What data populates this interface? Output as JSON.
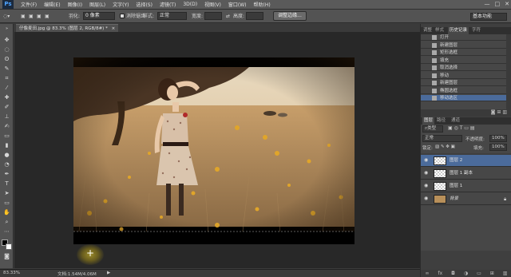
{
  "menubar": {
    "logo": "Ps",
    "items": [
      "文件(F)",
      "编辑(E)",
      "图像(I)",
      "图层(L)",
      "文字(Y)",
      "选择(S)",
      "滤镜(T)",
      "3D(D)",
      "视图(V)",
      "窗口(W)",
      "帮助(H)"
    ],
    "window_controls": [
      "—",
      "□",
      "✕"
    ]
  },
  "options": {
    "feather_label": "羽化:",
    "feather_value": "0 像素",
    "antialias_label": "消除锯齿",
    "style_label": "样式:",
    "style_value": "正常",
    "width_label": "宽度:",
    "height_label": "高度:",
    "refine_button": "调整边缘...",
    "workspace_value": "基本功能"
  },
  "document": {
    "tab_title": "仔像麦田.jpg @ 83.3% (图层 2, RGB/8#) *",
    "tab_close": "×"
  },
  "status": {
    "zoom": "83.33%",
    "doc_size": "文档:1.54M/4.06M"
  },
  "history_panel": {
    "tabs": [
      "调整",
      "样式",
      "历史记录",
      "字符"
    ],
    "active_tab": "历史记录",
    "items": [
      "打开",
      "新建图层",
      "矩形选框",
      "填充",
      "取消选择",
      "移动",
      "新建图层",
      "椭圆选框",
      "移动选区"
    ],
    "selected_index": 8
  },
  "layers_panel": {
    "tabs": [
      "图层",
      "路径",
      "通道"
    ],
    "active_tab": "图层",
    "filter_value": "类型",
    "blend_mode": "正常",
    "opacity_label": "不透明度:",
    "opacity_value": "100%",
    "lock_label": "锁定:",
    "fill_label": "填充:",
    "fill_value": "100%",
    "layers": [
      {
        "name": "图层 2",
        "selected": true
      },
      {
        "name": "图层 1 副本",
        "selected": false
      },
      {
        "name": "图层 1",
        "selected": false
      },
      {
        "name": "背景",
        "selected": false
      }
    ],
    "footer_icons": [
      "link-icon",
      "fx-icon",
      "mask-icon",
      "adjustment-icon",
      "folder-icon",
      "new-layer-icon",
      "trash-icon"
    ]
  },
  "colors": {
    "accent_selection": "#4b6b9b",
    "panel_bg": "#3f3f3f",
    "canvas_bg": "#282828"
  }
}
